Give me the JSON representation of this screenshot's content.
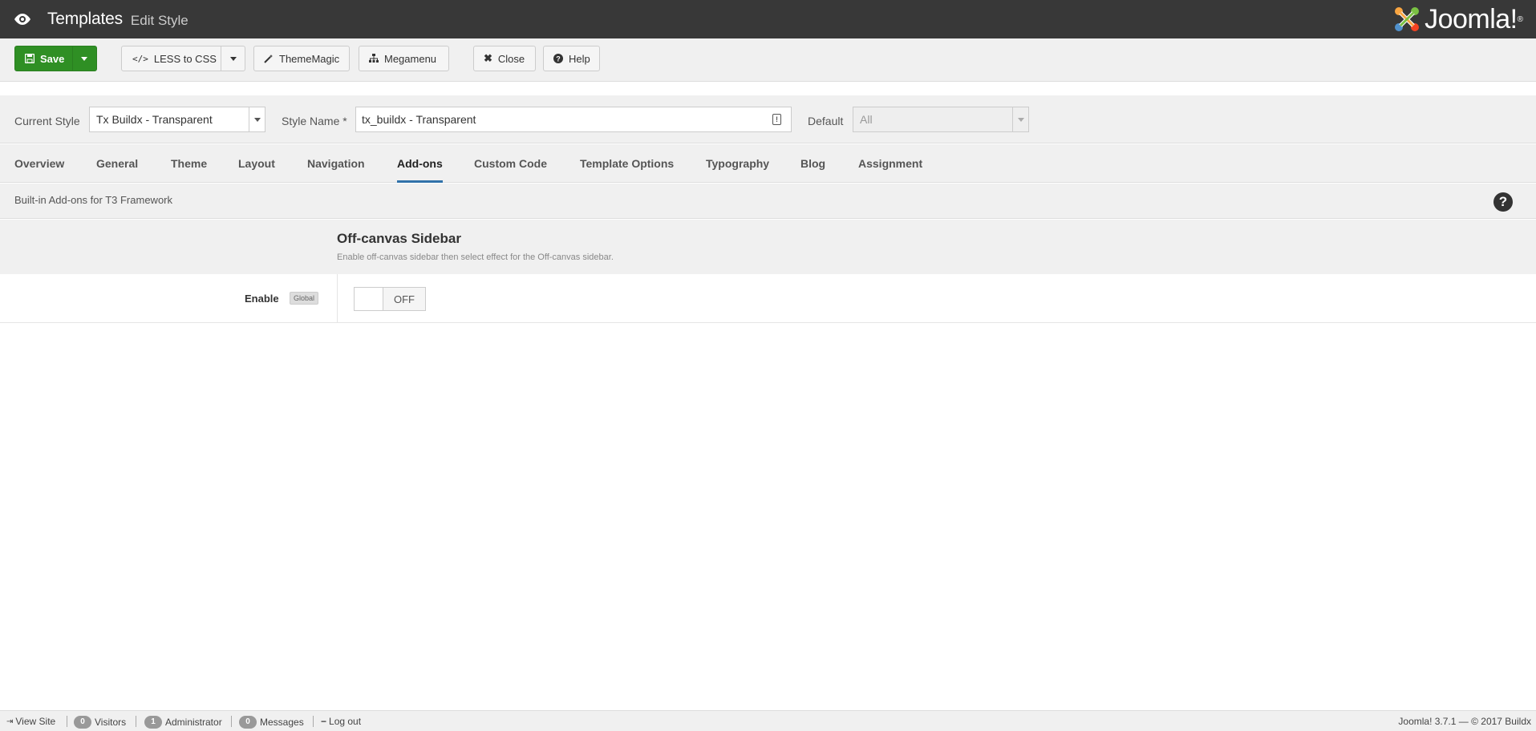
{
  "header": {
    "title": "Templates",
    "subtitle": "Edit Style",
    "logo_text": "Joomla!"
  },
  "toolbar": {
    "save_label": "Save",
    "less_label": "LESS to CSS",
    "thememagic_label": "ThemeMagic",
    "megamenu_label": "Megamenu",
    "close_label": "Close",
    "help_label": "Help"
  },
  "style_bar": {
    "current_style_label": "Current Style",
    "current_style_value": "Tx Buildx - Transparent",
    "style_name_label": "Style Name *",
    "style_name_value": "tx_buildx - Transparent",
    "default_label": "Default",
    "default_value": "All"
  },
  "tabs": [
    {
      "label": "Overview",
      "active": false
    },
    {
      "label": "General",
      "active": false
    },
    {
      "label": "Theme",
      "active": false
    },
    {
      "label": "Layout",
      "active": false
    },
    {
      "label": "Navigation",
      "active": false
    },
    {
      "label": "Add-ons",
      "active": true
    },
    {
      "label": "Custom Code",
      "active": false
    },
    {
      "label": "Template Options",
      "active": false
    },
    {
      "label": "Typography",
      "active": false
    },
    {
      "label": "Blog",
      "active": false
    },
    {
      "label": "Assignment",
      "active": false
    }
  ],
  "description": "Built-in Add-ons for T3 Framework",
  "section": {
    "title": "Off-canvas Sidebar",
    "desc": "Enable off-canvas sidebar then select effect for the Off-canvas sidebar."
  },
  "option": {
    "label": "Enable",
    "badge": "Global",
    "toggle_state": "OFF"
  },
  "footer": {
    "view_site": "View Site",
    "visitors_count": "0",
    "visitors_label": "Visitors",
    "admin_count": "1",
    "admin_label": "Administrator",
    "messages_count": "0",
    "messages_label": "Messages",
    "logout_label": "Log out",
    "version_text": "Joomla! 3.7.1  —  © 2017 Buildx"
  },
  "colors": {
    "header_bg": "#383838",
    "save_green": "#2f8f24",
    "tab_active_underline": "#3071a9"
  }
}
